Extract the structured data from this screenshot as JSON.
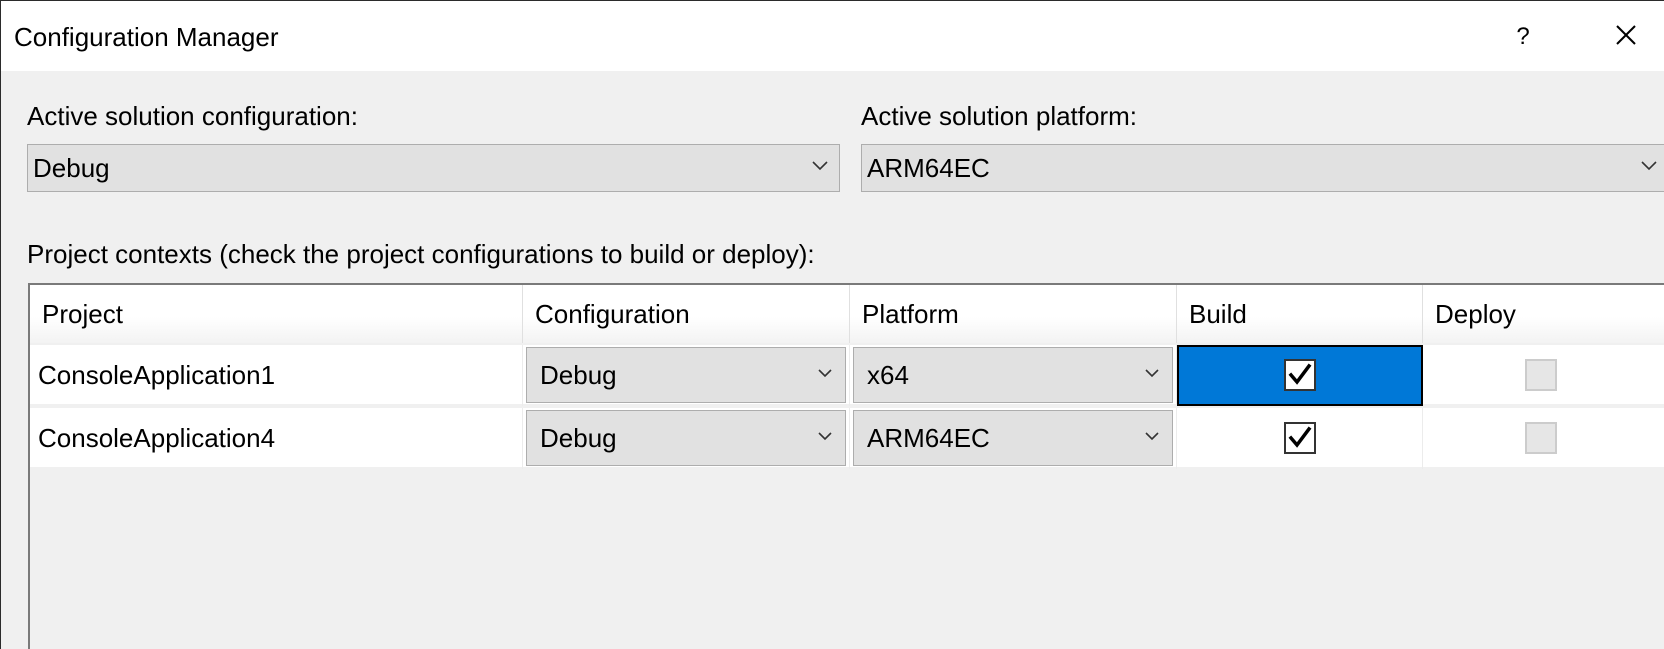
{
  "window": {
    "title": "Configuration Manager",
    "help_label": "?"
  },
  "active_configuration": {
    "label": "Active solution configuration:",
    "value": "Debug"
  },
  "active_platform": {
    "label": "Active solution platform:",
    "value": "ARM64EC"
  },
  "project_contexts": {
    "label": "Project contexts (check the project configurations to build or deploy):",
    "columns": [
      "Project",
      "Configuration",
      "Platform",
      "Build",
      "Deploy"
    ],
    "rows": [
      {
        "project": "ConsoleApplication1",
        "configuration": "Debug",
        "platform": "x64",
        "build": true,
        "deploy": false,
        "build_selected": true
      },
      {
        "project": "ConsoleApplication4",
        "configuration": "Debug",
        "platform": "ARM64EC",
        "build": true,
        "deploy": false,
        "build_selected": false
      }
    ]
  },
  "colors": {
    "selection": "#0078d7",
    "dialog_background": "#f0f0f0",
    "combo_background": "#e1e1e1"
  },
  "icons": {
    "help": "question-mark-icon",
    "close": "close-icon",
    "dropdown": "chevron-down-icon",
    "check": "checkmark-icon"
  }
}
